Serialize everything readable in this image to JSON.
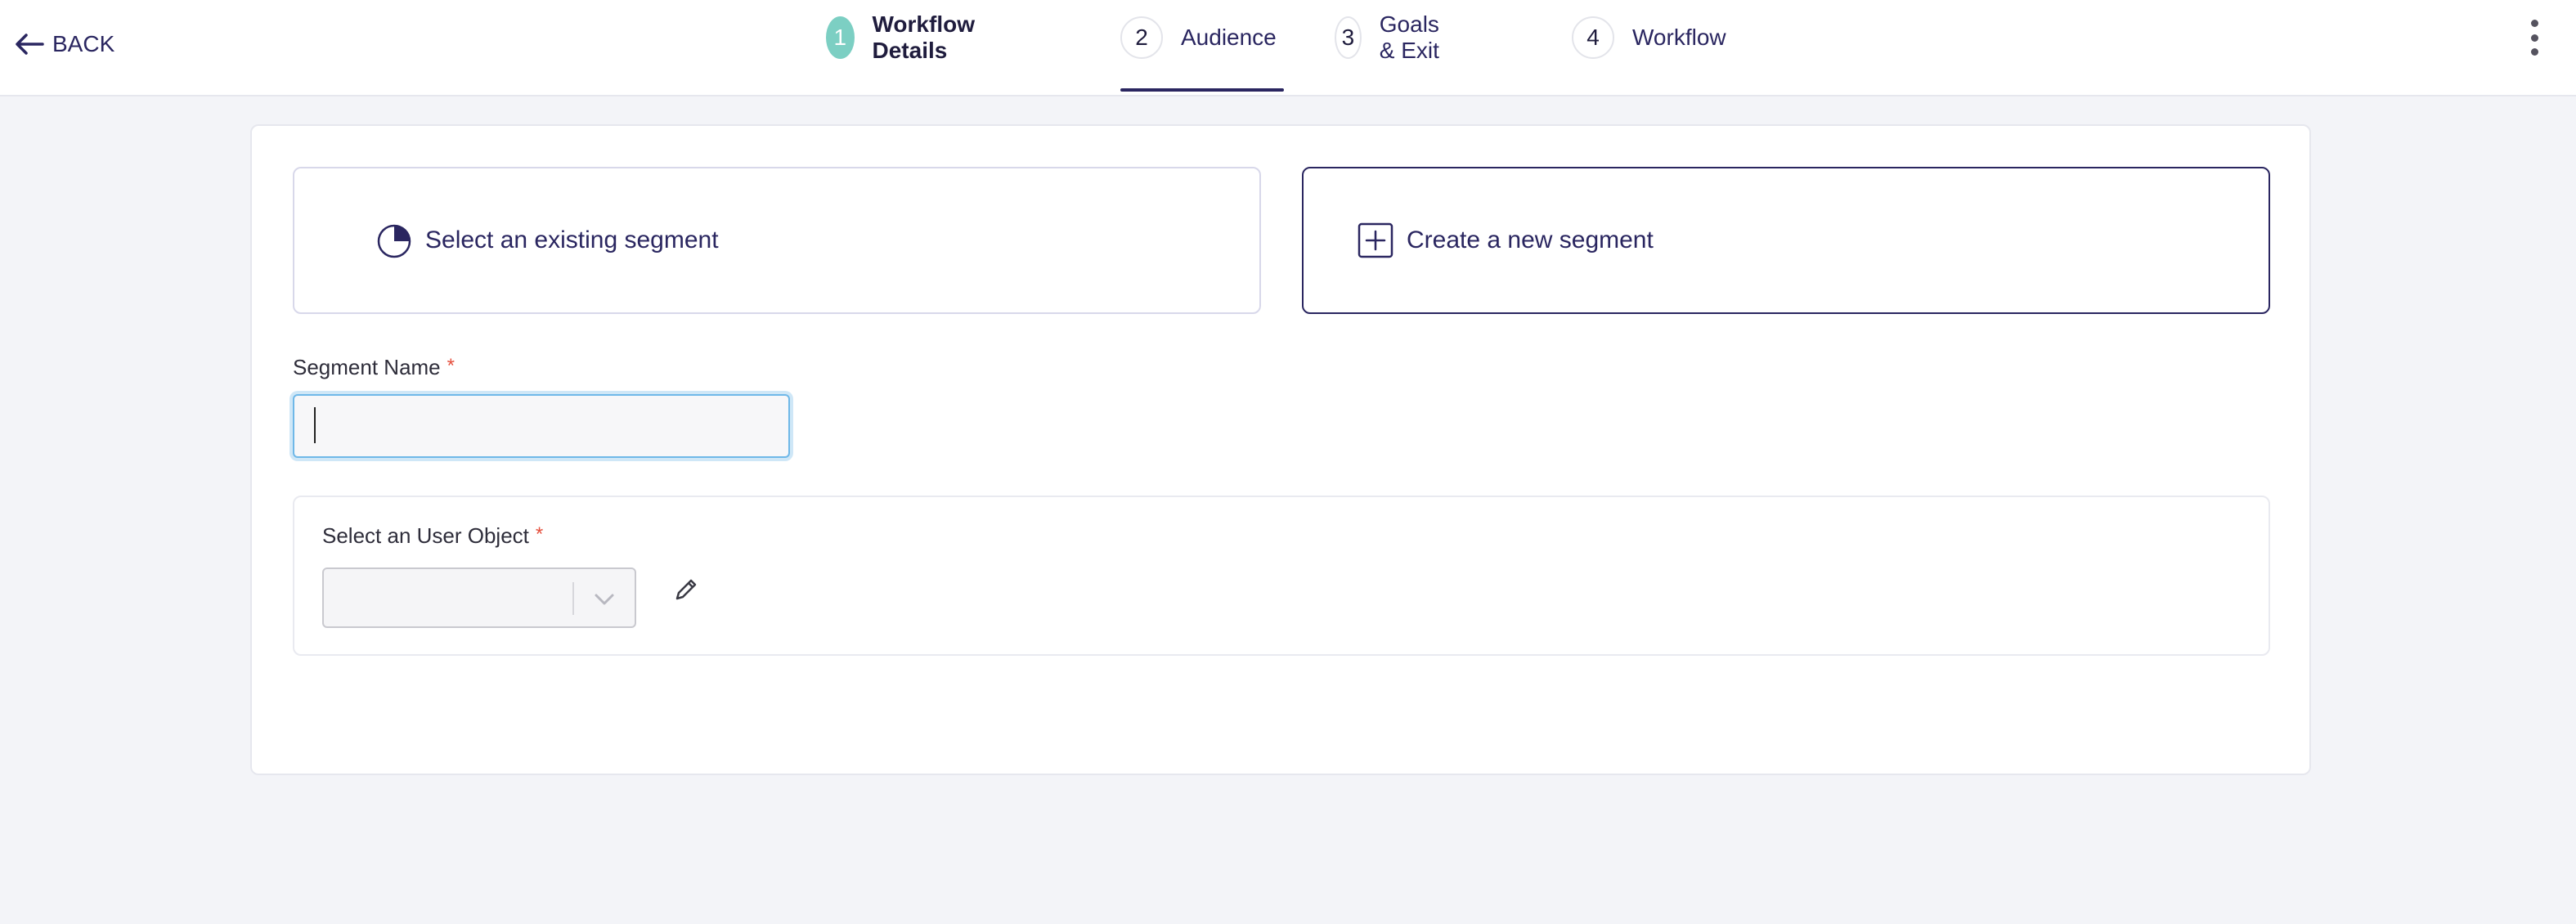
{
  "header": {
    "back_label": "BACK",
    "steps": [
      {
        "num": "1",
        "label": "Workflow Details",
        "state": "done"
      },
      {
        "num": "2",
        "label": "Audience",
        "state": "active"
      },
      {
        "num": "3",
        "label": "Goals & Exit",
        "state": "pending"
      },
      {
        "num": "4",
        "label": "Workflow",
        "state": "pending"
      }
    ]
  },
  "options": {
    "existing_label": "Select an existing segment",
    "create_label": "Create a new segment"
  },
  "form": {
    "segment_name_label": "Segment Name",
    "segment_name_value": "",
    "required_mark": "*",
    "user_object_label": "Select an User Object",
    "user_object_value": ""
  },
  "colors": {
    "primary": "#2a2660",
    "done_step": "#7ccfc3",
    "required": "#e5503e",
    "focus_ring": "#6fb8e8",
    "background": "#f3f4f8"
  },
  "icons": {
    "back": "arrow-left-icon",
    "existing": "pie-chart-icon",
    "create": "plus-square-icon",
    "menu": "more-vertical-icon",
    "dropdown": "chevron-down-icon",
    "edit": "pencil-icon"
  }
}
